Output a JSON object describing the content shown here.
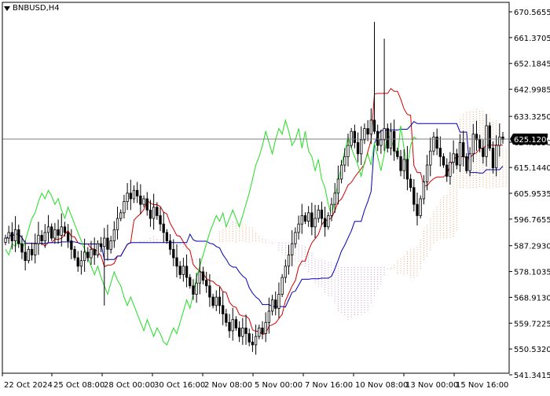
{
  "header": {
    "symbol": "BNBUSD,H4"
  },
  "price_badge": "625.1200",
  "colors": {
    "candle": "#000000",
    "tenkan": "#d40000",
    "kijun": "#0000b4",
    "chikou": "#22dd22",
    "cloud_bull": "#e8a878",
    "cloud_bear": "#c8a0c8",
    "grid": "#c8c8c8",
    "badge_bg": "#000000",
    "badge_text": "#ffffff"
  },
  "chart_data": {
    "type": "candlestick",
    "title": "BNBUSD,H4",
    "indicator": "Ichimoku",
    "grid": false,
    "ylim": [
      541.3415,
      670.5655
    ],
    "y_ticks": [
      "670.5655",
      "661.3705",
      "652.1845",
      "642.9985",
      "633.3250",
      "624.1390",
      "615.1440",
      "605.9535",
      "596.7655",
      "587.2930",
      "578.1035",
      "568.9130",
      "559.7225",
      "550.5320",
      "541.3415"
    ],
    "x_ticks": [
      "22 Oct 2024",
      "25 Oct 08:00",
      "28 Oct 00:00",
      "30 Oct 16:00",
      "2 Nov 08:00",
      "5 Nov 00:00",
      "7 Nov 16:00",
      "10 Nov 08:00",
      "13 Nov 00:00",
      "15 Nov 16:00"
    ],
    "last_price": 625.12,
    "close": [
      590,
      592,
      589,
      593,
      588,
      585,
      582,
      586,
      584,
      588,
      591,
      589,
      592,
      594,
      590,
      593,
      591,
      594,
      592,
      589,
      586,
      583,
      580,
      582,
      585,
      583,
      586,
      584,
      588,
      587,
      590,
      586,
      589,
      593,
      597,
      599,
      603,
      606,
      604,
      607,
      605,
      602,
      604,
      600,
      597,
      601,
      598,
      595,
      592,
      589,
      586,
      583,
      580,
      577,
      580,
      576,
      573,
      570,
      574,
      578,
      575,
      573,
      569,
      566,
      569,
      566,
      563,
      560,
      557,
      561,
      558,
      555,
      558,
      556,
      553,
      552,
      555,
      558,
      556,
      560,
      564,
      568,
      565,
      570,
      576,
      580,
      584,
      588,
      592,
      595,
      598,
      596,
      599,
      594,
      597,
      600,
      597,
      594,
      598,
      602,
      606,
      611,
      616,
      619,
      623,
      628,
      624,
      620,
      625,
      629,
      627,
      632,
      628,
      623,
      625,
      629,
      622,
      628,
      621,
      619,
      614,
      618,
      611,
      608,
      602,
      598,
      604,
      610,
      616,
      621,
      626,
      622,
      619,
      616,
      612,
      617,
      620,
      616,
      624,
      619,
      614,
      620,
      627,
      625,
      622,
      619,
      630,
      622,
      615,
      623,
      626,
      625.12
    ]
  }
}
